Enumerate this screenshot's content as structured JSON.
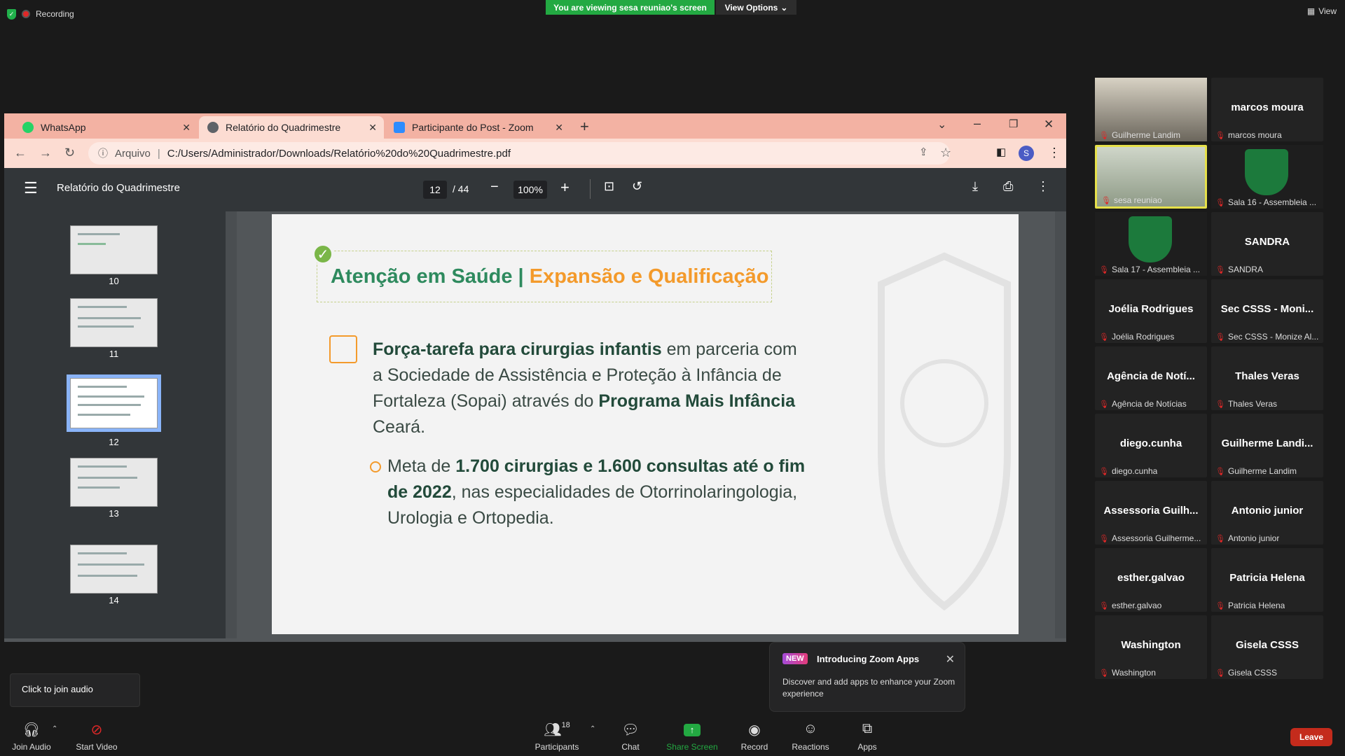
{
  "top_bar": {
    "recording": "Recording",
    "viewing": "You are viewing sesa reuniao's screen",
    "view_options": "View Options",
    "view": "View"
  },
  "browser": {
    "tabs": [
      {
        "label": "WhatsApp",
        "icon": "whatsapp-icon"
      },
      {
        "label": "Relatório do Quadrimestre",
        "icon": "globe-icon"
      },
      {
        "label": "Participante do Post - Zoom",
        "icon": "zoom-icon"
      }
    ],
    "address_prefix": "Arquivo",
    "url": "C:/Users/Administrador/Downloads/Relatório%20do%20Quadrimestre.pdf",
    "profile_initial": "S"
  },
  "pdf": {
    "title": "Relatório do Quadrimestre",
    "page": "12",
    "total_pages": "/ 44",
    "zoom": "100%",
    "thumbnails": [
      "10",
      "11",
      "12",
      "13",
      "14"
    ],
    "selected_page": "12"
  },
  "slide": {
    "title_green": "Atenção em Saúde |",
    "title_orange": "Expansão e Qualificação",
    "p1_bold1": "Força-tarefa para cirurgias infantis",
    "p1_text1": " em parceria com a Sociedade de Assistência e Proteção à Infância de Fortaleza (Sopai) através do ",
    "p1_bold2": "Programa Mais Infância",
    "p1_text2": " Ceará.",
    "p2_text1": "Meta de ",
    "p2_bold": "1.700 cirurgias e 1.600 consultas até o fim de 2022",
    "p2_text2": ", nas especialidades de Otorrinolaringologia, Urologia e Ortopedia."
  },
  "participants": [
    {
      "name": "",
      "label": "Guilherme Landim",
      "video": true
    },
    {
      "name": "marcos moura",
      "label": "marcos moura"
    },
    {
      "name": "",
      "label": "sesa reuniao",
      "video": true,
      "active": true
    },
    {
      "name": "",
      "label": "Sala 16 - Assembleia ...",
      "video": true
    },
    {
      "name": "",
      "label": "Sala 17 - Assembleia ...",
      "video": true
    },
    {
      "name": "SANDRA",
      "label": "SANDRA"
    },
    {
      "name": "Joélia Rodrigues",
      "label": "Joélia Rodrigues"
    },
    {
      "name": "Sec CSSS - Moni...",
      "label": "Sec CSSS - Monize Al..."
    },
    {
      "name": "Agência de Notí...",
      "label": "Agência de Notícias"
    },
    {
      "name": "Thales Veras",
      "label": "Thales Veras"
    },
    {
      "name": "diego.cunha",
      "label": "diego.cunha"
    },
    {
      "name": "Guilherme Landi...",
      "label": "Guilherme Landim"
    },
    {
      "name": "Assessoria Guilh...",
      "label": "Assessoria Guilherme..."
    },
    {
      "name": "Antonio junior",
      "label": "Antonio junior"
    },
    {
      "name": "esther.galvao",
      "label": "esther.galvao"
    },
    {
      "name": "Patricia Helena",
      "label": "Patricia Helena"
    },
    {
      "name": "Washington",
      "label": "Washington"
    },
    {
      "name": "Gisela CSSS",
      "label": "Gisela CSSS"
    }
  ],
  "popup": {
    "badge": "NEW",
    "title": "Introducing Zoom Apps",
    "body": "Discover and add apps to enhance your Zoom experience"
  },
  "audio_tip": "Click to join audio",
  "toolbar": {
    "join_audio": "Join Audio",
    "start_video": "Start Video",
    "participants": "Participants",
    "participant_count": "18",
    "chat": "Chat",
    "share_screen": "Share Screen",
    "record": "Record",
    "reactions": "Reactions",
    "apps": "Apps",
    "leave": "Leave"
  },
  "colors": {
    "share_green": "#23a942",
    "leave_red": "#c42b1c",
    "slide_green": "#2e8a5e",
    "slide_orange": "#f39a2b"
  }
}
